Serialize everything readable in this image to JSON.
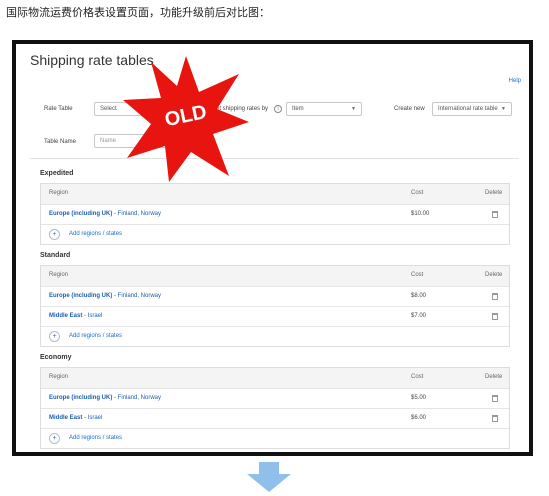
{
  "caption": "国际物流运费价格表设置页面，功能升级前后对比图：",
  "page": {
    "title": "Shipping rate tables",
    "help_label": "Help"
  },
  "controls": {
    "rate_table_label": "Rate Table",
    "rate_table_value": "Select",
    "set_rates_label": "Set shipping rates by",
    "set_rates_value": "Item",
    "create_new_label": "Create new",
    "create_new_value": "International rate table",
    "table_name_label": "Table Name",
    "table_name_placeholder": "Name"
  },
  "stamp": {
    "text": "OLD",
    "color": "#e8140f"
  },
  "columns": {
    "region": "Region",
    "cost": "Cost",
    "delete": "Delete"
  },
  "add_label": "Add regions / states",
  "sections": [
    {
      "title": "Expedited",
      "rows": [
        {
          "region": "Europe (including UK)",
          "detail": "- Finland, Norway",
          "cost": "$10.00"
        }
      ]
    },
    {
      "title": "Standard",
      "rows": [
        {
          "region": "Europe (including UK)",
          "detail": "- Finland, Norway",
          "cost": "$8.00"
        },
        {
          "region": "Middle East",
          "detail": "- Israel",
          "cost": "$7.00"
        }
      ]
    },
    {
      "title": "Economy",
      "rows": [
        {
          "region": "Europe (including UK)",
          "detail": "- Finland, Norway",
          "cost": "$5.00"
        },
        {
          "region": "Middle East",
          "detail": "- Israel",
          "cost": "$6.00"
        }
      ]
    }
  ],
  "colors": {
    "link": "#1a5fb4",
    "arrow": "#8fbfea"
  }
}
